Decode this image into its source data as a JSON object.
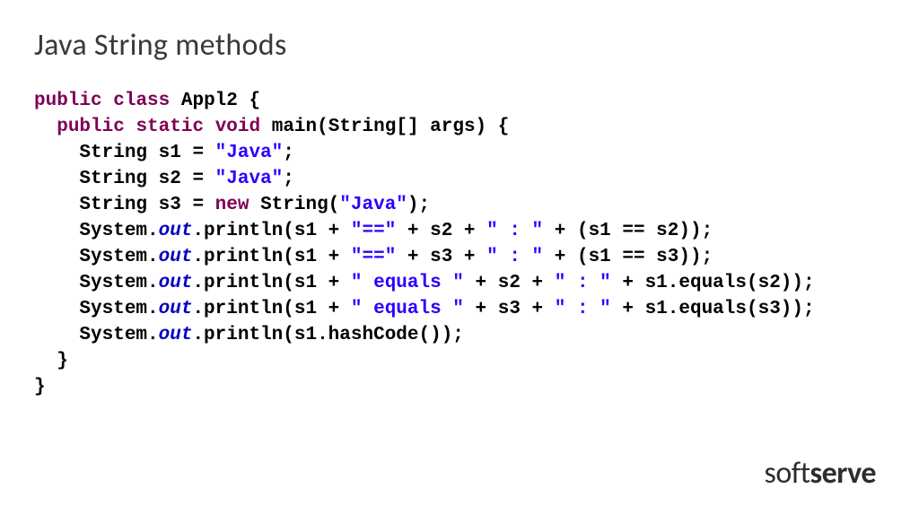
{
  "slide": {
    "title": "Java String methods",
    "code": {
      "line1": {
        "kw_public": "public",
        "kw_class": "class",
        "classname": "Appl2 {"
      },
      "line2": {
        "kw_public": "public",
        "kw_static": "static",
        "kw_void": "void",
        "rest": "main(String[] args) {"
      },
      "line3": {
        "pre": "String s1 = ",
        "str": "\"Java\"",
        "post": ";"
      },
      "line4": {
        "pre": "String s2 = ",
        "str": "\"Java\"",
        "post": ";"
      },
      "line5": {
        "pre": "String s3 = ",
        "kw_new": "new",
        "mid": " String(",
        "str": "\"Java\"",
        "post": ");"
      },
      "line6": {
        "pre": "System.",
        "out": "out",
        "mid1": ".println(s1 + ",
        "str1": "\"==\"",
        "mid2": " + s2 + ",
        "str2": "\" : \"",
        "post": " + (s1 == s2));"
      },
      "line7": {
        "pre": "System.",
        "out": "out",
        "mid1": ".println(s1 + ",
        "str1": "\"==\"",
        "mid2": " + s3 + ",
        "str2": "\" : \"",
        "post": " + (s1 == s3));"
      },
      "line8": {
        "pre": "System.",
        "out": "out",
        "mid1": ".println(s1 + ",
        "str1": "\" equals \"",
        "mid2": " + s2 + ",
        "str2": "\" : \"",
        "post": " + s1.equals(s2));"
      },
      "line9": {
        "pre": "System.",
        "out": "out",
        "mid1": ".println(s1 + ",
        "str1": "\" equals \"",
        "mid2": " + s3 + ",
        "str2": "\" : \"",
        "post": " + s1.equals(s3));"
      },
      "line10": {
        "pre": "System.",
        "out": "out",
        "post": ".println(s1.hashCode());"
      },
      "line11": "  }",
      "line12": "}"
    }
  },
  "logo": {
    "part1": "soft",
    "part2": "serve"
  }
}
